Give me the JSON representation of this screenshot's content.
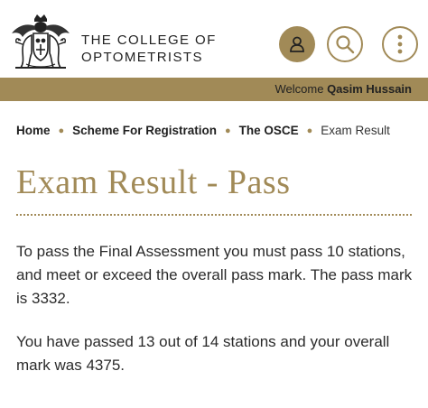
{
  "header": {
    "brand_line1": "THE COLLEGE OF",
    "brand_line2": "OPTOMETRISTS",
    "crest_icon": "college-crest-logo",
    "account_icon": "person-icon",
    "search_icon": "search-icon",
    "more_icon": "more-vertical-icon"
  },
  "welcome": {
    "prefix": "Welcome",
    "name": "Qasim Hussain"
  },
  "breadcrumb": {
    "items": [
      "Home",
      "Scheme For Registration",
      "The OSCE"
    ],
    "current": "Exam Result"
  },
  "page": {
    "title": "Exam Result - Pass",
    "paragraph1": "To pass the Final Assessment you must pass 10 stations, and meet or exceed the overall pass mark. The pass mark is 3332.",
    "paragraph2": "You have passed 13 out of 14 stations and your overall mark was 4375."
  },
  "colors": {
    "accent": "#a18a57",
    "text": "#2b2b2b"
  }
}
